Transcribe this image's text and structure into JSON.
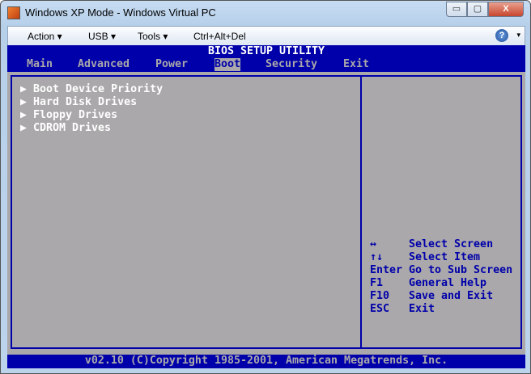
{
  "window": {
    "title": "Windows XP Mode - Windows Virtual PC",
    "controls": {
      "minimize": "▭",
      "restore": "▢",
      "close": "X"
    }
  },
  "toolbar": {
    "items": [
      "Action ▾",
      "USB ▾",
      "Tools ▾",
      "Ctrl+Alt+Del"
    ],
    "help": "?",
    "help_dropdown": "▾"
  },
  "bios": {
    "title": "BIOS SETUP UTILITY",
    "tabs": [
      "Main",
      "Advanced",
      "Power",
      "Boot",
      "Security",
      "Exit"
    ],
    "active_tab": "Boot",
    "items": [
      "Boot Device Priority",
      "Hard Disk Drives",
      "Floppy Drives",
      "CDROM Drives"
    ],
    "item_marker": "▶",
    "help": [
      {
        "key": "↔",
        "desc": "Select Screen"
      },
      {
        "key": "↑↓",
        "desc": "Select Item"
      },
      {
        "key": "Enter",
        "desc": "Go to Sub Screen"
      },
      {
        "key": "F1",
        "desc": "General Help"
      },
      {
        "key": "F10",
        "desc": "Save and Exit"
      },
      {
        "key": "ESC",
        "desc": "Exit"
      }
    ],
    "footer": "v02.10 (C)Copyright 1985-2001, American Megatrends, Inc."
  },
  "colors": {
    "blue": "#0000aa",
    "gray": "#aaa8aa",
    "white": "#ffffff"
  }
}
